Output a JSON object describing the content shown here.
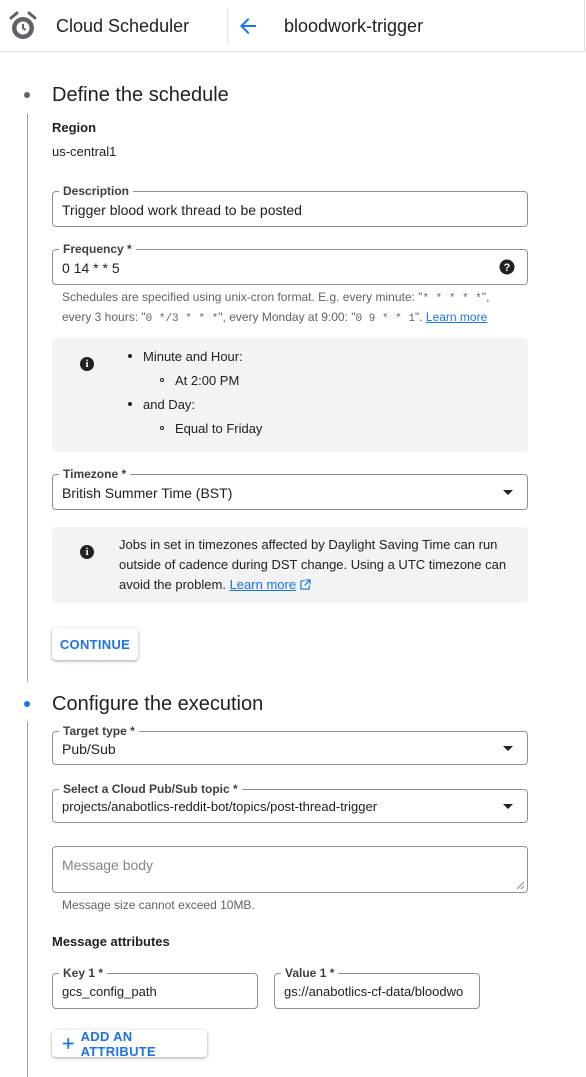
{
  "header": {
    "app_name": "Cloud Scheduler",
    "page_title": "bloodwork-trigger"
  },
  "step1": {
    "title": "Define the schedule",
    "region_label": "Region",
    "region_value": "us-central1",
    "description": {
      "label": "Description",
      "value": "Trigger blood work thread to be posted"
    },
    "frequency": {
      "label": "Frequency *",
      "value": "0 14 * * 5",
      "help_part1": "Schedules are specified using unix-cron format. E.g. every minute: \"",
      "help_code1": "* * * * *",
      "help_part2": "\",",
      "help_part3": "every 3 hours: \"",
      "help_code2": "0 */3 * * *",
      "help_part4": "\", every Monday at 9:00: \"",
      "help_code3": "0 9 * * 1",
      "help_part5": "\". ",
      "help_link": "Learn more"
    },
    "summary": {
      "item1": "Minute and Hour:",
      "item1_sub": "At 2:00 PM",
      "item2": "and Day:",
      "item2_sub": "Equal to Friday"
    },
    "timezone": {
      "label": "Timezone *",
      "value": "British Summer Time (BST)"
    },
    "dst_note": {
      "line1": "Jobs in set in timezones affected by Daylight Saving Time can run",
      "line2": "outside of cadence during DST change. Using a UTC timezone can",
      "line3": "avoid the problem. ",
      "link": "Learn more"
    },
    "continue_label": "CONTINUE"
  },
  "step2": {
    "title": "Configure the execution",
    "target_type": {
      "label": "Target type *",
      "value": "Pub/Sub"
    },
    "topic": {
      "label": "Select a Cloud Pub/Sub topic *",
      "value": "projects/anabotlics-reddit-bot/topics/post-thread-trigger"
    },
    "message_body": {
      "placeholder": "Message body",
      "helper": "Message size cannot exceed 10MB."
    },
    "attributes_label": "Message attributes",
    "key1": {
      "label": "Key 1 *",
      "value": "gcs_config_path"
    },
    "value1": {
      "label": "Value 1 *",
      "value": "gs://anabotlics-cf-data/bloodwo"
    },
    "add_attribute_label": "ADD AN ATTRIBUTE"
  },
  "colors": {
    "accent": "#1a73e8",
    "info_bg": "#f1f3f4",
    "border": "#8e9094",
    "active_step": "#1a73e8",
    "done_step": "#5f6368"
  },
  "icons": [
    "alarm-clock-icon",
    "arrow-left-icon",
    "help-icon",
    "info-icon",
    "dropdown-caret-icon",
    "external-link-icon",
    "plus-icon"
  ]
}
